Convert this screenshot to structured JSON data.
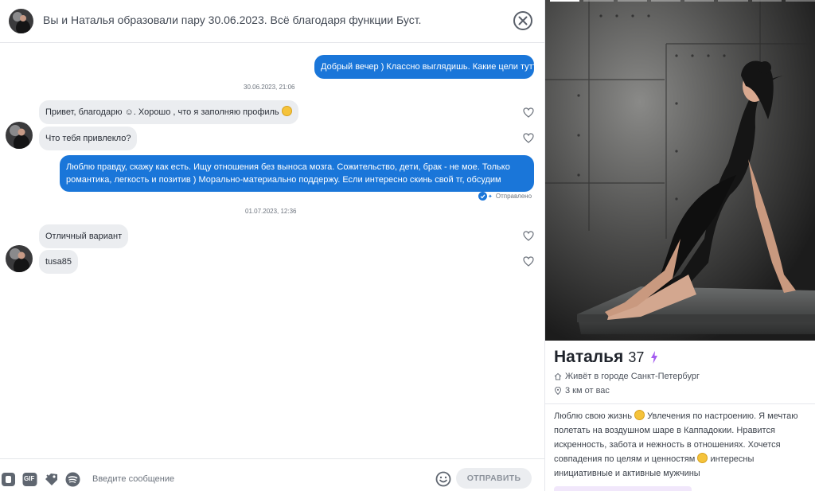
{
  "header": {
    "title": "Вы и Наталья образовали пару 30.06.2023. Всё благодаря функции Буст."
  },
  "messages": {
    "m1": "Добрый вечер ) Классно выглядишь. Какие цели тут?",
    "ts1": "30.06.2023, 21:06",
    "m2": "Привет, благодарю ☺. Хорошо , что я заполняю профиль",
    "m3": "Что тебя привлекло?",
    "m4_line1": "Люблю правду, скажу как есть. Ищу отношения без выноса мозга. Сожительство, дети, брак - не мое. Только",
    "m4_line2": "романтика, легкость и позитив ) Морально-материально поддержу. Если интересно скинь свой тг, обсудим",
    "status": "Отправлено",
    "ts2": "01.07.2023, 12:36",
    "m5": "Отличный вариант",
    "m6": "tusa85"
  },
  "composer": {
    "placeholder": "Введите сообщение",
    "send_label": "ОТПРАВИТЬ",
    "gif_label": "GIF"
  },
  "profile": {
    "name": "Наталья",
    "age": "37",
    "location": "Живёт в городе Санкт-Петербург",
    "distance": "3 км от вас",
    "bio_1": "Люблю свою жизнь",
    "bio_2": "Увлечения по настроению. Я мечтаю полетать на воздушном шаре в Каппадокии. Нравится искренность, забота и нежность в отношениях. Хочется совпадения по целям и ценностям",
    "bio_3": "интересны инициативные и активные мужчины",
    "accent_color": "#a45cf0"
  },
  "colors": {
    "outgoing_bubble": "#1a76d9",
    "incoming_bubble": "#ebedf0"
  }
}
